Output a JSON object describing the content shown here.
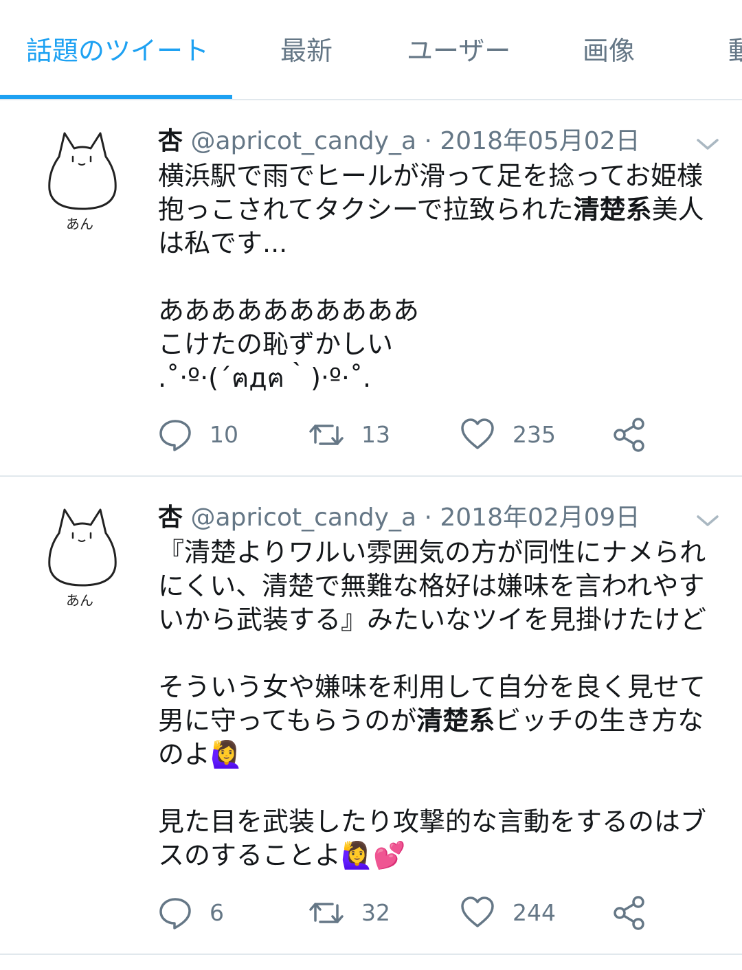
{
  "tabs": [
    {
      "label": "話題のツイート",
      "active": true
    },
    {
      "label": "最新"
    },
    {
      "label": "ユーザー"
    },
    {
      "label": "画像"
    },
    {
      "label": "動"
    }
  ],
  "colors": {
    "accent": "#1da1f2",
    "muted": "#657786",
    "text": "#14171a",
    "divider": "#e1e8ed"
  },
  "tweets": [
    {
      "avatar_caption": "あん",
      "display_name": "杏",
      "handle": "@apricot_candy_a",
      "separator": "·",
      "date": "2018年05月02日",
      "lines": [
        [
          {
            "t": "横浜駅で雨でヒールが滑って足を捻ってお姫様"
          }
        ],
        [
          {
            "t": "抱っこされてタクシーで拉致られた"
          },
          {
            "t": "清楚系",
            "b": true
          },
          {
            "t": "美人"
          }
        ],
        [
          {
            "t": "は私です..."
          }
        ],
        [],
        [
          {
            "t": "ああああああああああ"
          }
        ],
        [
          {
            "t": "こけたの恥ずかしい"
          }
        ],
        [
          {
            "t": ".˚‧º·(´ฅдฅ｀)‧º·˚."
          }
        ]
      ],
      "replies": "10",
      "retweets": "13",
      "likes": "235"
    },
    {
      "avatar_caption": "あん",
      "display_name": "杏",
      "handle": "@apricot_candy_a",
      "separator": "·",
      "date": "2018年02月09日",
      "lines": [
        [
          {
            "t": "『清楚よりワルい雰囲気の方が同性にナメられ"
          }
        ],
        [
          {
            "t": "にくい、清楚で無難な格好は嫌味を言われやす"
          }
        ],
        [
          {
            "t": "いから武装する』みたいなツイを見掛けたけど"
          }
        ],
        [],
        [
          {
            "t": "そういう女や嫌味を利用して自分を良く見せて"
          }
        ],
        [
          {
            "t": "男に守ってもらうのが"
          },
          {
            "t": "清楚系",
            "b": true
          },
          {
            "t": "ビッチの生き方な"
          }
        ],
        [
          {
            "t": "のよ🙋‍♀️"
          }
        ],
        [],
        [
          {
            "t": "見た目を武装したり攻撃的な言動をするのはブ"
          }
        ],
        [
          {
            "t": "スのすることよ🙋‍♀️💕"
          }
        ]
      ],
      "replies": "6",
      "retweets": "32",
      "likes": "244"
    }
  ]
}
